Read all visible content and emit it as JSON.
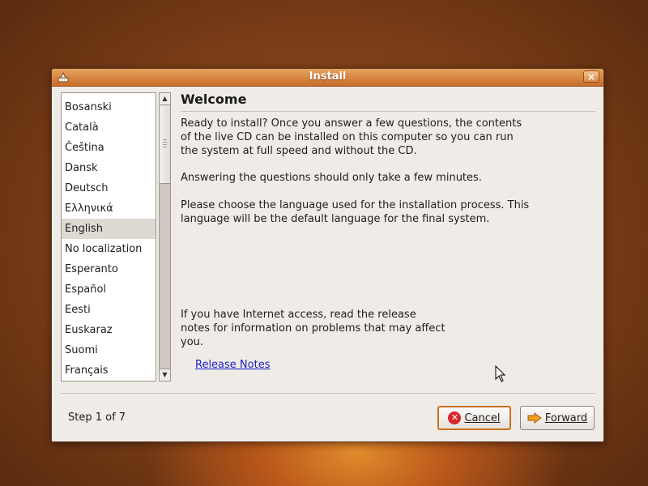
{
  "window": {
    "title": "Install",
    "close_label": "×"
  },
  "languages": {
    "items": [
      "Bosanski",
      "Català",
      "Čeština",
      "Dansk",
      "Deutsch",
      "Ελληνικά",
      "English",
      "No localization",
      "Esperanto",
      "Español",
      "Eesti",
      "Euskaraz",
      "Suomi",
      "Français"
    ],
    "selected": "English"
  },
  "content": {
    "heading": "Welcome",
    "para1": "Ready to install? Once you answer a few questions, the contents of the live CD can be installed on this computer so you can run the system at full speed and without the CD.",
    "para2": "Answering the questions should only take a few minutes.",
    "para3": "Please choose the language used for the installation process. This language will be the default language for the final system.",
    "para4": "If you have Internet access, read the release notes for information on problems that may affect you.",
    "release_notes_link": "Release Notes"
  },
  "footer": {
    "step": "Step 1 of 7",
    "cancel_label": "Cancel",
    "forward_label": "Forward"
  },
  "colors": {
    "accent": "#c9701f",
    "link": "#1c1ec8",
    "selection": "#ded9d2"
  }
}
